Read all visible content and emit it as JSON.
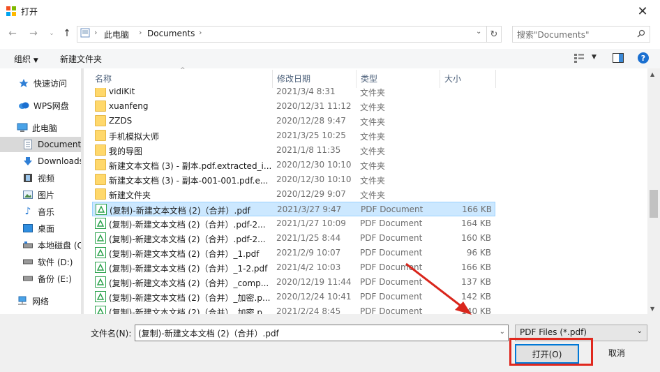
{
  "window": {
    "title": "打开"
  },
  "nav": {
    "breadcrumb": [
      "此电脑",
      "Documents"
    ],
    "search_placeholder": "搜索\"Documents\""
  },
  "toolbar": {
    "organize": "组织",
    "new_folder": "新建文件夹"
  },
  "sidebar": {
    "items": [
      {
        "label": "快速访问",
        "icon": "star-icon"
      },
      {
        "label": "WPS网盘",
        "icon": "cloud-icon"
      },
      {
        "label": "此电脑",
        "icon": "computer-icon"
      },
      {
        "label": "Documents",
        "icon": "document-icon"
      },
      {
        "label": "Downloads",
        "icon": "download-icon"
      },
      {
        "label": "视频",
        "icon": "video-icon"
      },
      {
        "label": "图片",
        "icon": "picture-icon"
      },
      {
        "label": "音乐",
        "icon": "music-icon"
      },
      {
        "label": "桌面",
        "icon": "desktop-icon"
      },
      {
        "label": "本地磁盘 (C",
        "icon": "drive-icon"
      },
      {
        "label": "软件 (D:)",
        "icon": "drive-icon"
      },
      {
        "label": "备份 (E:)",
        "icon": "drive-icon"
      },
      {
        "label": "网络",
        "icon": "network-icon"
      }
    ]
  },
  "columns": {
    "name": "名称",
    "date": "修改日期",
    "type": "类型",
    "size": "大小"
  },
  "rows": [
    {
      "name": "vidiKit",
      "date": "2021/3/4 8:31",
      "type": "文件夹",
      "size": "",
      "kind": "folder"
    },
    {
      "name": "xuanfeng",
      "date": "2020/12/31 11:12",
      "type": "文件夹",
      "size": "",
      "kind": "folder"
    },
    {
      "name": "ZZDS",
      "date": "2020/12/28 9:47",
      "type": "文件夹",
      "size": "",
      "kind": "folder"
    },
    {
      "name": "手机模拟大师",
      "date": "2021/3/25 10:25",
      "type": "文件夹",
      "size": "",
      "kind": "folder"
    },
    {
      "name": "我的导图",
      "date": "2021/1/8 11:35",
      "type": "文件夹",
      "size": "",
      "kind": "folder"
    },
    {
      "name": "新建文本文档 (3) - 副本.pdf.extracted_i...",
      "date": "2020/12/30 10:10",
      "type": "文件夹",
      "size": "",
      "kind": "folder"
    },
    {
      "name": "新建文本文档 (3) - 副本-001-001.pdf.e...",
      "date": "2020/12/30 10:10",
      "type": "文件夹",
      "size": "",
      "kind": "folder"
    },
    {
      "name": "新建文件夹",
      "date": "2020/12/29 9:07",
      "type": "文件夹",
      "size": "",
      "kind": "folder"
    },
    {
      "name": "(复制)-新建文本文档 (2)（合并）.pdf",
      "date": "2021/3/27 9:47",
      "type": "PDF Document",
      "size": "166 KB",
      "kind": "pdf",
      "selected": true
    },
    {
      "name": "(复制)-新建文本文档 (2)（合并）.pdf-2...",
      "date": "2021/1/27 10:09",
      "type": "PDF Document",
      "size": "164 KB",
      "kind": "pdf"
    },
    {
      "name": "(复制)-新建文本文档 (2)（合并）.pdf-2...",
      "date": "2021/1/25 8:44",
      "type": "PDF Document",
      "size": "160 KB",
      "kind": "pdf"
    },
    {
      "name": "(复制)-新建文本文档 (2)（合并）_1.pdf",
      "date": "2021/2/9 10:07",
      "type": "PDF Document",
      "size": "96 KB",
      "kind": "pdf"
    },
    {
      "name": "(复制)-新建文本文档 (2)（合并）_1-2.pdf",
      "date": "2021/4/2 10:03",
      "type": "PDF Document",
      "size": "166 KB",
      "kind": "pdf"
    },
    {
      "name": "(复制)-新建文本文档 (2)（合并）_comp...",
      "date": "2020/12/19 11:44",
      "type": "PDF Document",
      "size": "137 KB",
      "kind": "pdf"
    },
    {
      "name": "(复制)-新建文本文档 (2)（合并）_加密.p...",
      "date": "2020/12/24 10:41",
      "type": "PDF Document",
      "size": "142 KB",
      "kind": "pdf"
    },
    {
      "name": "(复制)-新建文本文档 (2)（合并）_加密.p...",
      "date": "2021/2/24 8:45",
      "type": "PDF Document",
      "size": "140 KB",
      "kind": "pdf"
    }
  ],
  "bottom": {
    "filename_label": "文件名(N):",
    "filename_value": "(复制)-新建文本文档 (2)（合并）.pdf",
    "filter_value": "PDF Files (*.pdf)",
    "open_label": "打开(O)",
    "cancel_label": "取消"
  },
  "colors": {
    "selection": "#cce8ff",
    "highlight_box": "#e0281e",
    "arrow": "#d9261c",
    "accent": "#0078d7"
  }
}
